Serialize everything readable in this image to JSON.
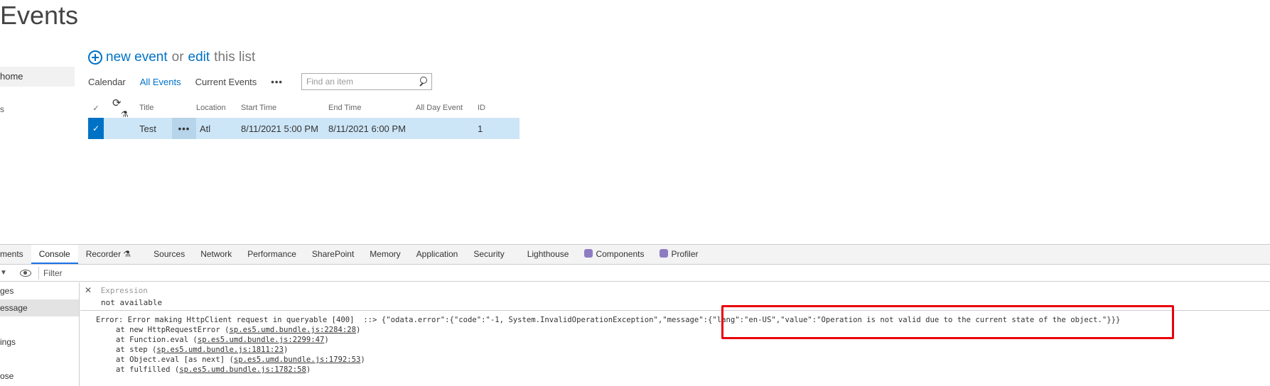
{
  "page": {
    "title": "Events"
  },
  "left_nav": {
    "items": [
      {
        "label": "home",
        "selected": true
      },
      {
        "label": "s",
        "selected": false
      }
    ]
  },
  "actions": {
    "new_event": "new event",
    "or": "or",
    "edit": "edit",
    "this_list": "this list"
  },
  "views": {
    "tabs": [
      "Calendar",
      "All Events",
      "Current Events"
    ],
    "active": "All Events",
    "more": "•••",
    "search_placeholder": "Find an item"
  },
  "list": {
    "columns": {
      "title": "Title",
      "location": "Location",
      "start": "Start Time",
      "end": "End Time",
      "allday": "All Day Event",
      "id": "ID"
    },
    "rows": [
      {
        "title": "Test",
        "location": "Atl",
        "start": "8/11/2021 5:00 PM",
        "end": "8/11/2021 6:00 PM",
        "allday": "",
        "id": "1",
        "menu": "•••"
      }
    ]
  },
  "devtools": {
    "tabs": [
      "ments",
      "Console",
      "Recorder ⚗",
      "Sources",
      "Network",
      "Performance",
      "SharePoint",
      "Memory",
      "Application",
      "Security",
      "Lighthouse",
      "Components",
      "Profiler"
    ],
    "active_tab": "Console",
    "filter_placeholder": "Filter",
    "side_items": [
      "ges",
      "essage",
      "",
      "ings",
      "",
      "ose"
    ],
    "expression": {
      "label": "Expression",
      "value": "not available"
    },
    "error": {
      "line1": "Error: Error making HttpClient request in queryable [400]  ::> {\"odata.error\":{\"code\":\"-1, System.InvalidOperationException\",\"message\":{\"lang\":\"en-US\",\"value\":\"Operation is not valid due to the current state of the object.\"}}}",
      "stack": [
        {
          "prefix": "at new HttpRequestError (",
          "link": "sp.es5.umd.bundle.js:2284:28",
          "suffix": ")"
        },
        {
          "prefix": "at Function.eval (",
          "link": "sp.es5.umd.bundle.js:2299:47",
          "suffix": ")"
        },
        {
          "prefix": "at step (",
          "link": "sp.es5.umd.bundle.js:1811:23",
          "suffix": ")"
        },
        {
          "prefix": "at Object.eval [as next] (",
          "link": "sp.es5.umd.bundle.js:1792:53",
          "suffix": ")"
        },
        {
          "prefix": "at fulfilled (",
          "link": "sp.es5.umd.bundle.js:1782:58",
          "suffix": ")"
        }
      ]
    }
  },
  "colors": {
    "accent": "#0072c6",
    "selected_row": "#cde6f7",
    "highlight_box": "#e8000b"
  }
}
